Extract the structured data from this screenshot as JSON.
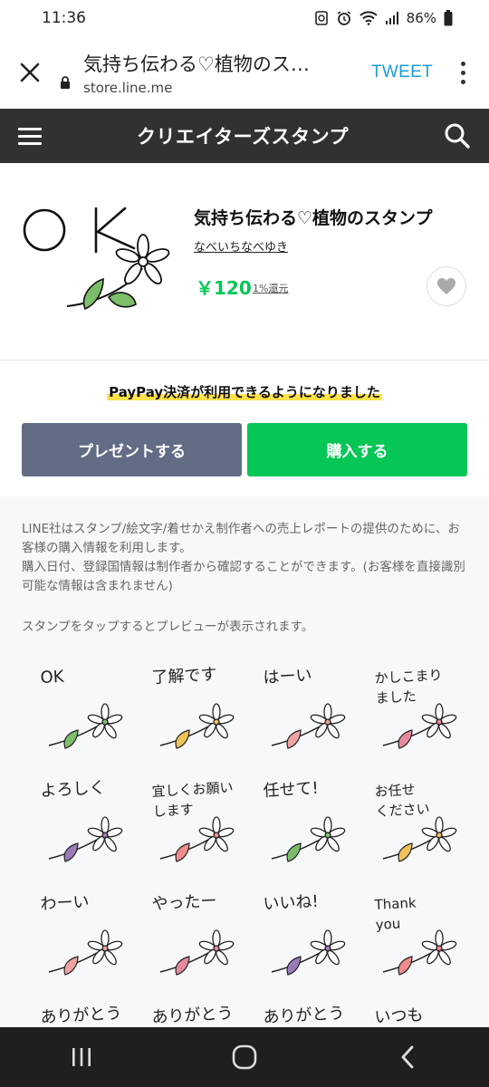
{
  "status_bar": {
    "time": "11:36",
    "battery": "86%"
  },
  "browser": {
    "page_title": "気持ち伝わる♡植物のスタ...",
    "host": "store.line.me",
    "tweet_label": "TWEET"
  },
  "header": {
    "title": "クリエイターズスタンプ"
  },
  "product": {
    "main_text": "OK",
    "title": "気持ち伝わる♡植物のスタンプ",
    "author": "なべいちなべゆき",
    "price": "￥120",
    "rebate": "1%還元"
  },
  "banner": {
    "paypay": "PayPay決済が利用できるようになりました"
  },
  "buttons": {
    "present": "プレゼントする",
    "buy": "購入する"
  },
  "notice": {
    "line1": "LINE社はスタンプ/絵文字/着せかえ制作者への売上レポートの提供のために、お客様の購入情報を利用します。",
    "line2": "購入日付、登録国情報は制作者から確認することができます。(お客様を直接識別可能な情報は含まれません)",
    "preview_hint": "スタンプをタップするとプレビューが表示されます。"
  },
  "stickers": [
    {
      "label": "OK"
    },
    {
      "label": "了解です"
    },
    {
      "label": "はーい"
    },
    {
      "label": "かしこまり\nました"
    },
    {
      "label": "よろしく"
    },
    {
      "label": "宜しくお願い\nします"
    },
    {
      "label": "任せて!"
    },
    {
      "label": "お任せ\nください"
    },
    {
      "label": "わーい"
    },
    {
      "label": "やったー"
    },
    {
      "label": "いいね!"
    },
    {
      "label": "Thank\nyou"
    },
    {
      "label": "ありがとう"
    },
    {
      "label": "ありがとう"
    },
    {
      "label": "ありがとう"
    },
    {
      "label": "いつも"
    }
  ],
  "colors": {
    "line_green": "#06c755",
    "header_dark": "#2f3133",
    "present_gray": "#626c84",
    "tweet_blue": "#1d9bd8"
  }
}
